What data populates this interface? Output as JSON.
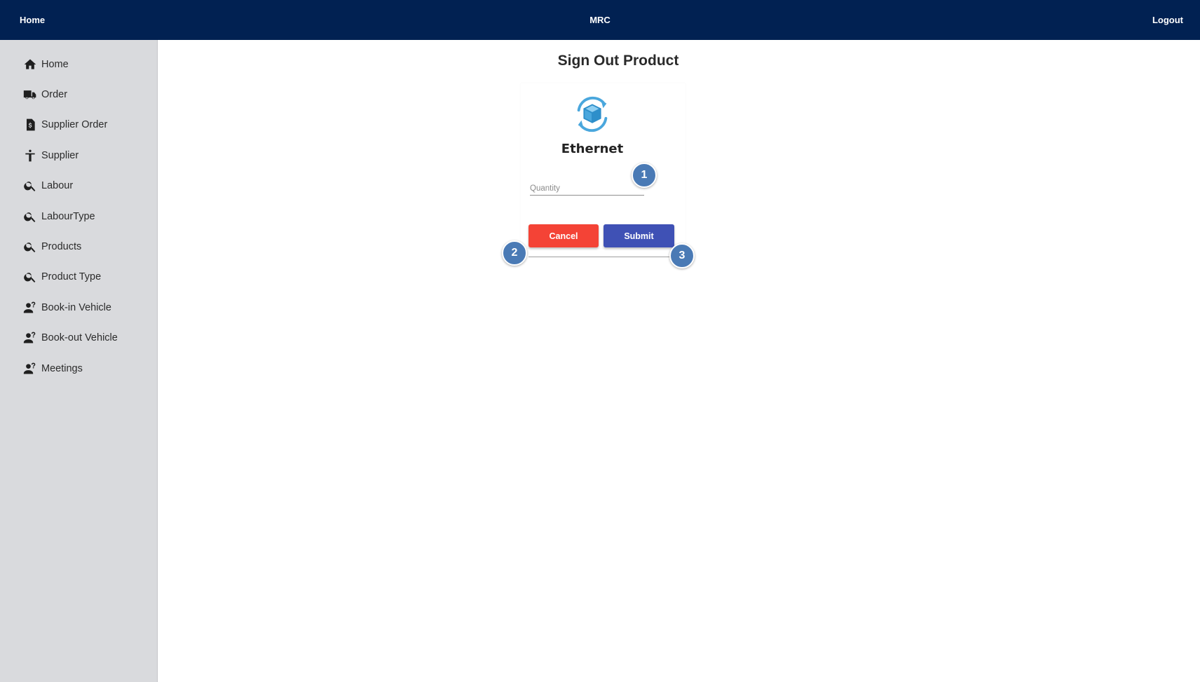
{
  "topbar": {
    "home_label": "Home",
    "brand": "MRC",
    "logout_label": "Logout",
    "background": "#012152"
  },
  "sidebar": {
    "items": [
      {
        "label": "Home",
        "icon": "home-icon"
      },
      {
        "label": "Order",
        "icon": "truck-icon"
      },
      {
        "label": "Supplier Order",
        "icon": "invoice-dollar-icon"
      },
      {
        "label": "Supplier",
        "icon": "person-icon"
      },
      {
        "label": "Labour",
        "icon": "search-icon"
      },
      {
        "label": "LabourType",
        "icon": "search-icon"
      },
      {
        "label": "Products",
        "icon": "search-icon"
      },
      {
        "label": "Product Type",
        "icon": "search-icon"
      },
      {
        "label": "Book-in Vehicle",
        "icon": "person-question-icon"
      },
      {
        "label": "Book-out Vehicle",
        "icon": "person-question-icon"
      },
      {
        "label": "Meetings",
        "icon": "person-question-icon"
      }
    ]
  },
  "main": {
    "title": "Sign Out Product",
    "product": {
      "name": "Ethernet",
      "icon": "box-sync-icon"
    },
    "quantity_field": {
      "placeholder": "Quantity",
      "value": ""
    },
    "cancel_label": "Cancel",
    "submit_label": "Submit",
    "cancel_color": "#f44336",
    "submit_color": "#3f51b5"
  },
  "markers": [
    "1",
    "2",
    "3"
  ]
}
